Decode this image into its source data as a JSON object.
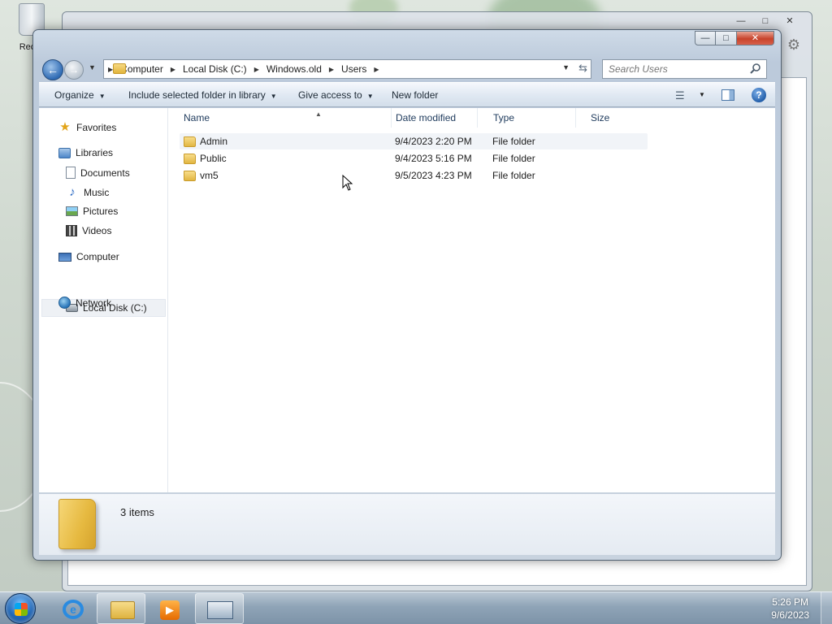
{
  "desktop": {
    "recycle_bin_label": "Recyc"
  },
  "window": {
    "controls": {
      "minimize": "—",
      "maximize": "□",
      "close": "✕"
    }
  },
  "address": {
    "crumbs": [
      "Computer",
      "Local Disk (C:)",
      "Windows.old",
      "Users"
    ]
  },
  "search": {
    "placeholder": "Search Users"
  },
  "toolbar": {
    "organize": "Organize",
    "include_library": "Include selected folder in library",
    "give_access": "Give access to",
    "new_folder": "New folder"
  },
  "nav": {
    "favorites": "Favorites",
    "libraries": "Libraries",
    "documents": "Documents",
    "music": "Music",
    "pictures": "Pictures",
    "videos": "Videos",
    "computer": "Computer",
    "local_disk": "Local Disk (C:)",
    "network": "Network"
  },
  "columns": {
    "name": "Name",
    "date_modified": "Date modified",
    "type": "Type",
    "size": "Size"
  },
  "files": [
    {
      "name": "Admin",
      "date": "9/4/2023 2:20 PM",
      "type": "File folder",
      "size": ""
    },
    {
      "name": "Public",
      "date": "9/4/2023 5:16 PM",
      "type": "File folder",
      "size": ""
    },
    {
      "name": "vm5",
      "date": "9/5/2023 4:23 PM",
      "type": "File folder",
      "size": ""
    }
  ],
  "details": {
    "count": "3 items"
  },
  "taskbar": {
    "time": "5:26 PM",
    "date": "9/6/2023"
  },
  "colors": {
    "accent": "#2f6bb4",
    "folder": "#e2b642",
    "link_text": "#1e3a5c"
  }
}
